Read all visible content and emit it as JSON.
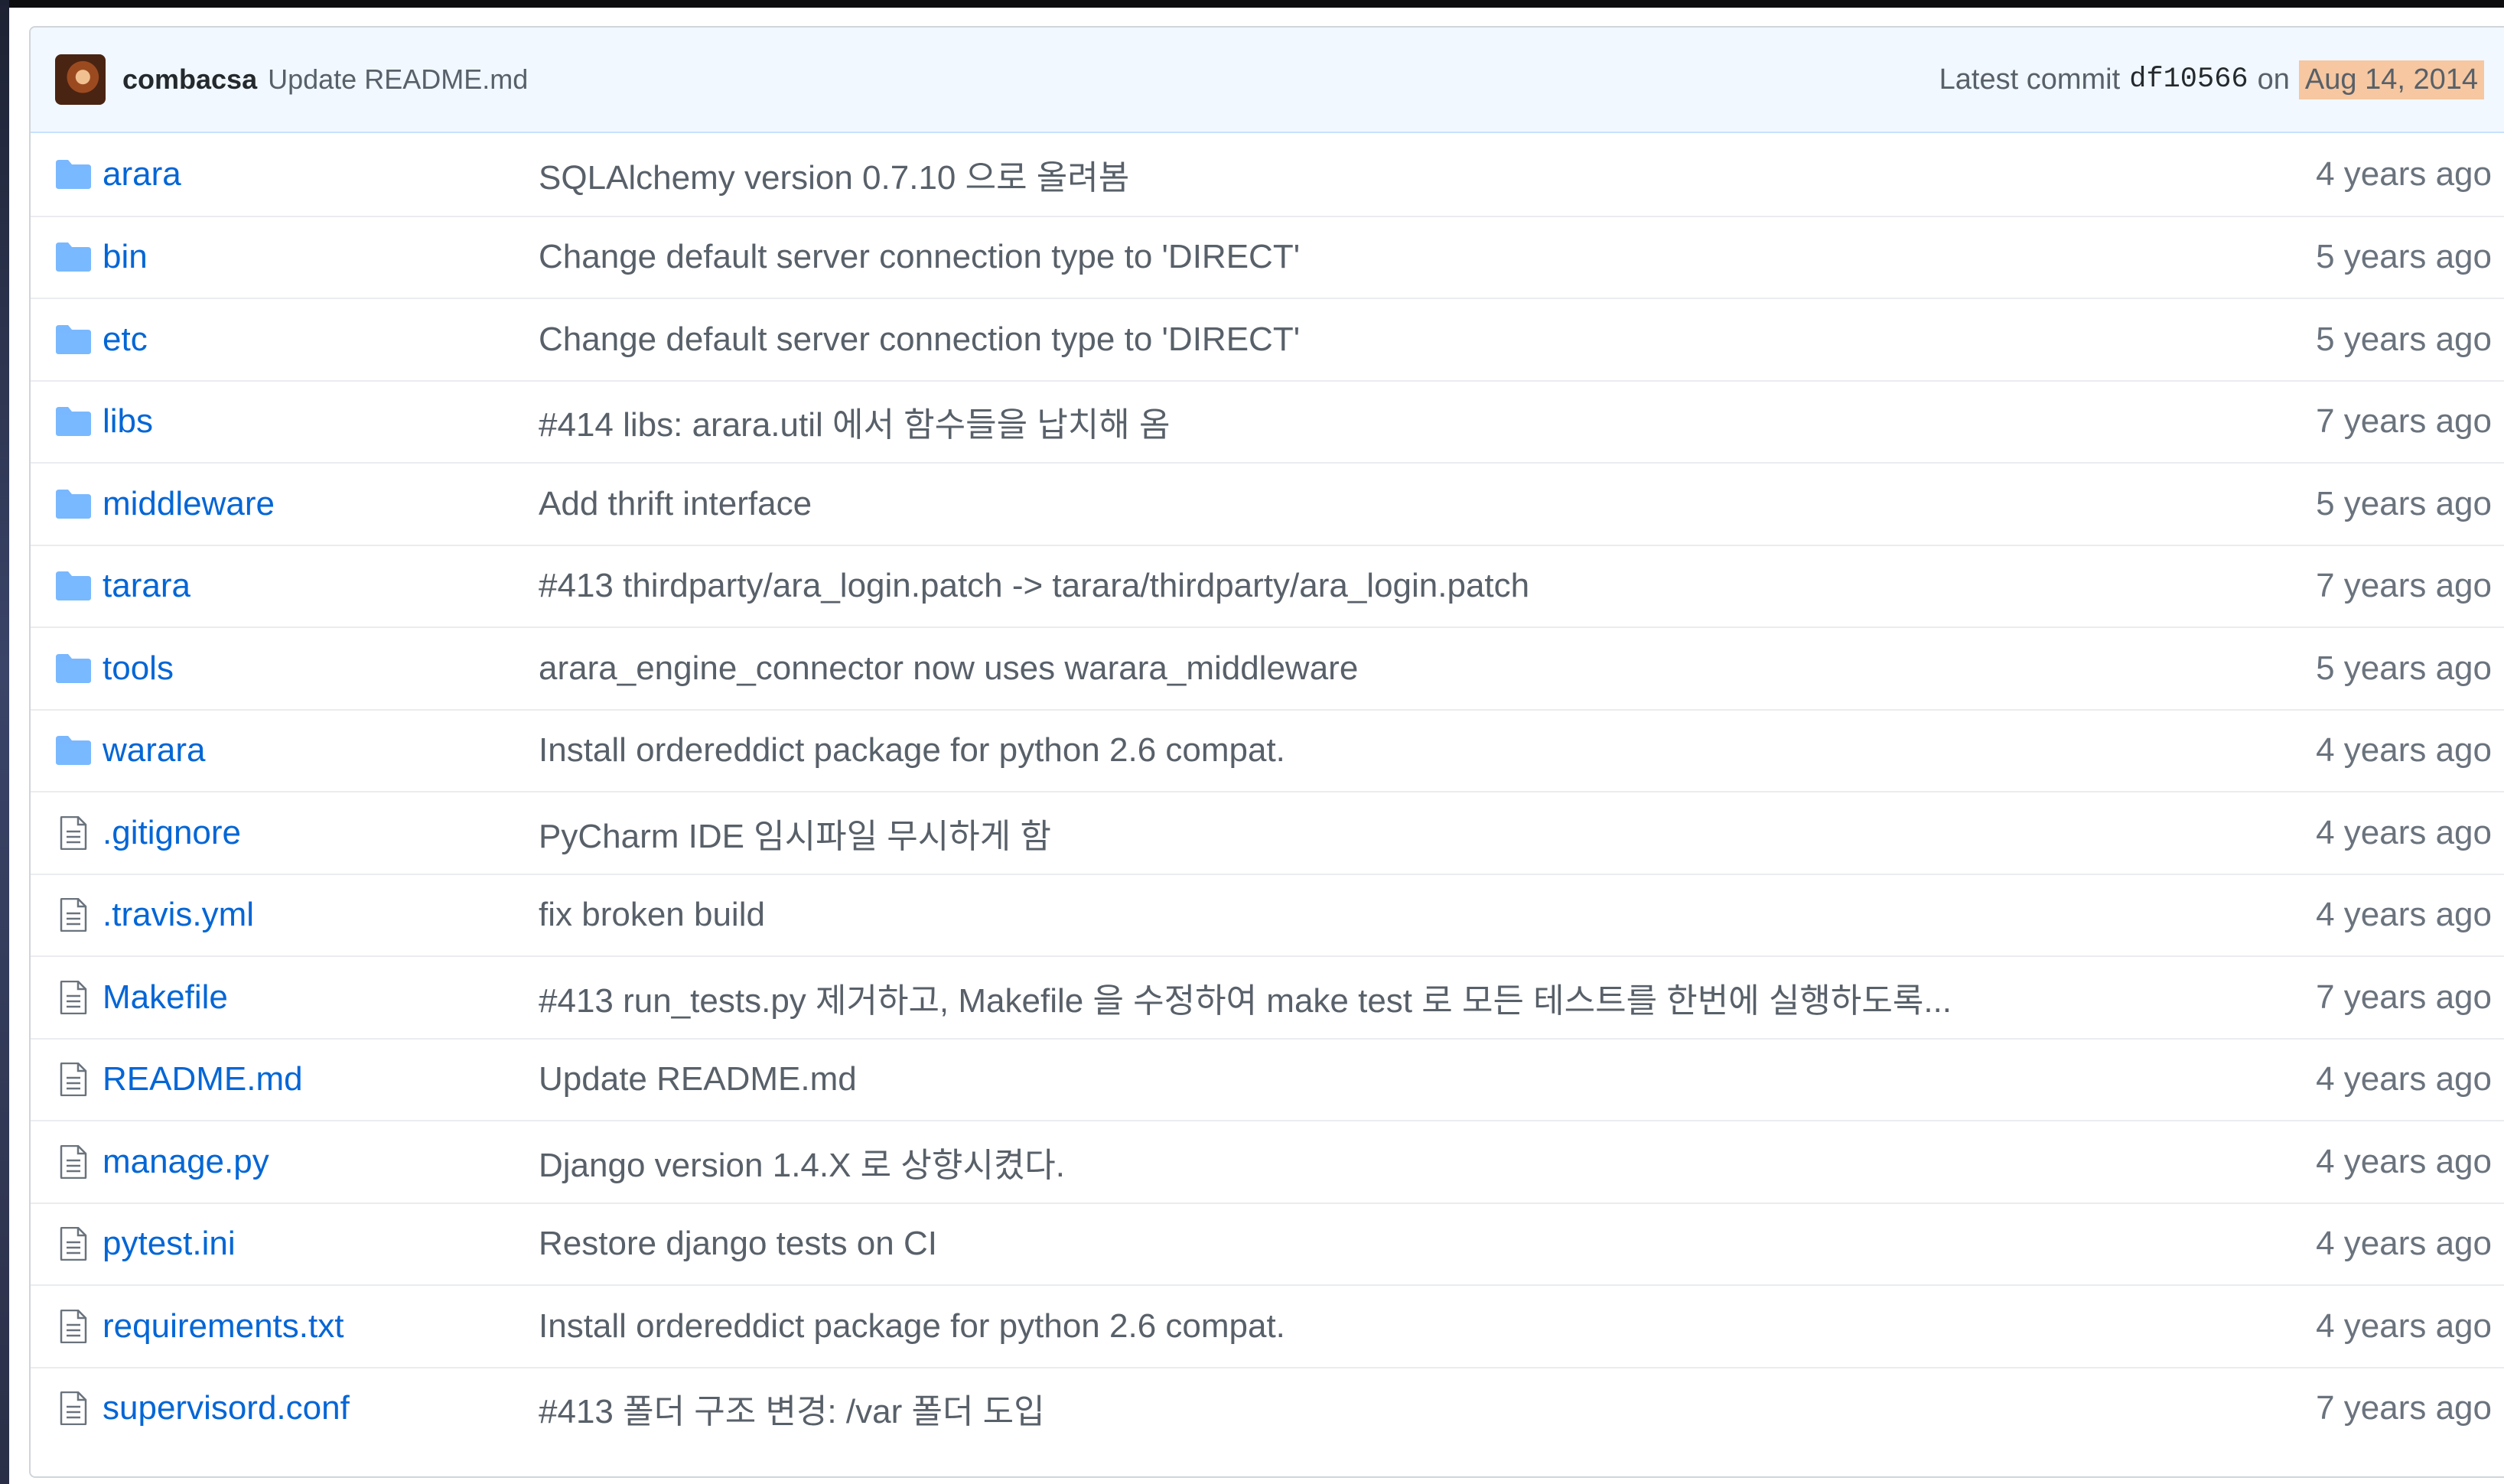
{
  "commit": {
    "author": "combacsa",
    "message": "Update README.md",
    "prefix": "Latest commit",
    "sha": "df10566",
    "on": "on",
    "date": "Aug 14, 2014"
  },
  "files": [
    {
      "type": "dir",
      "name": "arara",
      "message": "SQLAlchemy version 0.7.10 으로 올려봄",
      "age": "4 years ago"
    },
    {
      "type": "dir",
      "name": "bin",
      "message": "Change default server connection type to 'DIRECT'",
      "age": "5 years ago"
    },
    {
      "type": "dir",
      "name": "etc",
      "message": "Change default server connection type to 'DIRECT'",
      "age": "5 years ago"
    },
    {
      "type": "dir",
      "name": "libs",
      "message": "#414 libs: arara.util 에서 함수들을 납치해 옴",
      "age": "7 years ago"
    },
    {
      "type": "dir",
      "name": "middleware",
      "message": "Add thrift interface",
      "age": "5 years ago"
    },
    {
      "type": "dir",
      "name": "tarara",
      "message": "#413 thirdparty/ara_login.patch -> tarara/thirdparty/ara_login.patch",
      "age": "7 years ago"
    },
    {
      "type": "dir",
      "name": "tools",
      "message": "arara_engine_connector now uses warara_middleware",
      "age": "5 years ago"
    },
    {
      "type": "dir",
      "name": "warara",
      "message": "Install ordereddict package for python 2.6 compat.",
      "age": "4 years ago"
    },
    {
      "type": "file",
      "name": ".gitignore",
      "message": "PyCharm IDE 임시파일 무시하게 함",
      "age": "4 years ago"
    },
    {
      "type": "file",
      "name": ".travis.yml",
      "message": "fix broken build",
      "age": "4 years ago"
    },
    {
      "type": "file",
      "name": "Makefile",
      "message": "#413 run_tests.py 제거하고, Makefile 을 수정하여 make test 로 모든 테스트를 한번에 실행하도록...",
      "age": "7 years ago"
    },
    {
      "type": "file",
      "name": "README.md",
      "message": "Update README.md",
      "age": "4 years ago"
    },
    {
      "type": "file",
      "name": "manage.py",
      "message": "Django version 1.4.X 로 상향시켰다.",
      "age": "4 years ago"
    },
    {
      "type": "file",
      "name": "pytest.ini",
      "message": "Restore django tests on CI",
      "age": "4 years ago"
    },
    {
      "type": "file",
      "name": "requirements.txt",
      "message": "Install ordereddict package for python 2.6 compat.",
      "age": "4 years ago"
    },
    {
      "type": "file",
      "name": "supervisord.conf",
      "message": "#413 폴더 구조 변경: /var 폴더 도입",
      "age": "7 years ago"
    }
  ],
  "icons": {
    "dir": "folder-icon",
    "file": "file-icon"
  },
  "colors": {
    "link": "#0366d6",
    "muted": "#586069",
    "commit_bg": "#f1f8ff",
    "date_highlight": "#f6c7a0"
  }
}
